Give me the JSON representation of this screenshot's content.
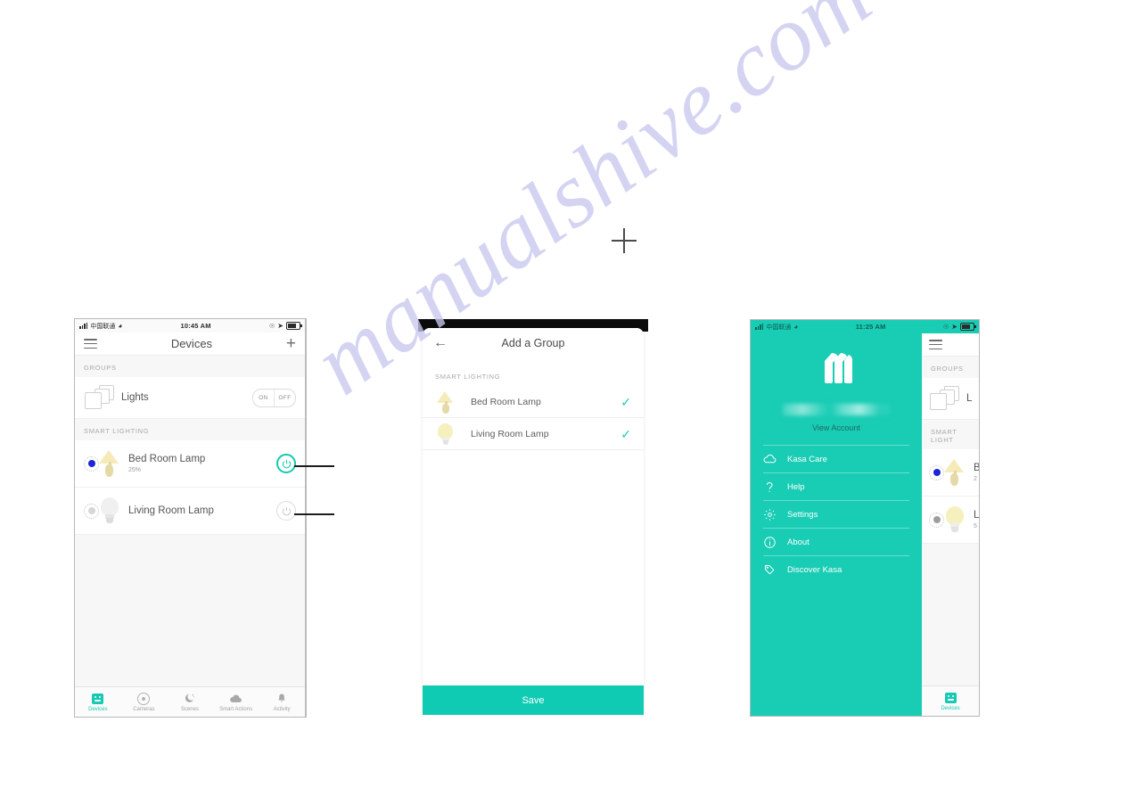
{
  "watermark": {
    "text": "manualshive.com"
  },
  "phone1": {
    "status": {
      "carrier": "中国联通",
      "time": "10:45 AM"
    },
    "header": {
      "title": "Devices",
      "menu_icon": "hamburger-icon",
      "add_icon": "plus-icon"
    },
    "sections": [
      {
        "label": "GROUPS"
      },
      {
        "label": "SMART LIGHTING"
      }
    ],
    "group_row": {
      "name": "Lights",
      "icon": "stacked-squares-icon",
      "toggle": {
        "on_label": "ON",
        "off_label": "OFF"
      }
    },
    "devices": [
      {
        "name": "Bed Room Lamp",
        "sub": "25%",
        "icon": "table-lamp-icon",
        "state": "on",
        "dot_color": "#1a26d8",
        "lamp_color": "#f3e6b2"
      },
      {
        "name": "Living Room Lamp",
        "sub": "",
        "icon": "bulb-icon",
        "state": "off",
        "dot_color": "#cccccc",
        "lamp_color": "#ececec"
      }
    ],
    "tabs": [
      {
        "label": "Devices",
        "icon": "devices-icon",
        "active": true
      },
      {
        "label": "Cameras",
        "icon": "camera-icon",
        "active": false
      },
      {
        "label": "Scenes",
        "icon": "moon-icon",
        "active": false
      },
      {
        "label": "Smart Actions",
        "icon": "cloud-gear-icon",
        "active": false
      },
      {
        "label": "Activity",
        "icon": "bell-icon",
        "active": false
      }
    ]
  },
  "phone2": {
    "header": {
      "title": "Add a Group",
      "back_icon": "back-arrow-icon"
    },
    "section_label": "SMART LIGHTING",
    "items": [
      {
        "name": "Bed Room Lamp",
        "icon": "table-lamp-icon",
        "checked": true,
        "check_icon": "check-icon"
      },
      {
        "name": "Living Room Lamp",
        "icon": "bulb-icon",
        "checked": true,
        "check_icon": "check-icon"
      }
    ],
    "save_label": "Save"
  },
  "phone3": {
    "status": {
      "carrier": "中国联通",
      "time": "11:25 AM"
    },
    "drawer": {
      "logo": "kasa-house-logo",
      "account_name_redacted": "",
      "view_account_label": "View Account",
      "menu": [
        {
          "label": "Kasa Care",
          "icon": "cloud-icon"
        },
        {
          "label": "Help",
          "icon": "question-mark-icon"
        },
        {
          "label": "Settings",
          "icon": "gear-icon"
        },
        {
          "label": "About",
          "icon": "info-circle-icon"
        },
        {
          "label": "Discover Kasa",
          "icon": "tag-icon"
        }
      ]
    },
    "behind": {
      "sections": [
        {
          "label": "GROUPS"
        },
        {
          "label": "SMART LIGHT"
        }
      ],
      "group_name": "L",
      "devices": [
        {
          "name": "B",
          "sub": "2",
          "dot_color": "#1a26d8",
          "lamp_color": "#f3e6b2"
        },
        {
          "name": "L",
          "sub": "5",
          "dot_color": "#9e9e9e",
          "lamp_color": "#f2f0c0"
        }
      ],
      "tab": {
        "label": "Devices",
        "icon": "devices-icon"
      }
    }
  },
  "colors": {
    "teal": "#19ccb4",
    "teal_dark": "#10cbb3",
    "blue_dot": "#1a26d8",
    "gray_text": "#8d8d8d"
  }
}
